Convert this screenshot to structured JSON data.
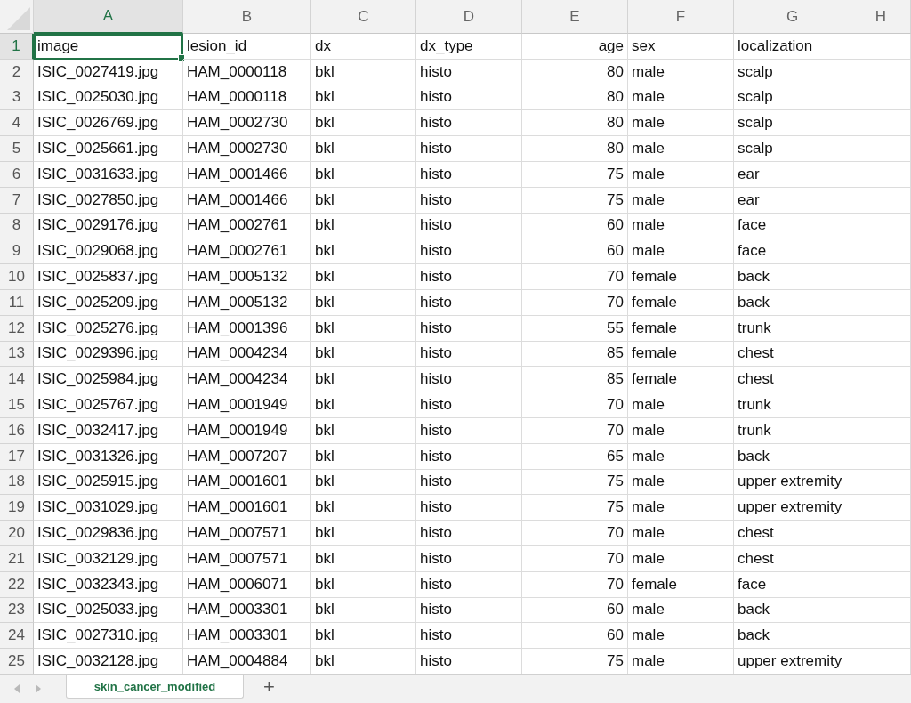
{
  "columns": [
    {
      "letter": "A",
      "selected": true,
      "kind": "text"
    },
    {
      "letter": "B",
      "selected": false,
      "kind": "text"
    },
    {
      "letter": "C",
      "selected": false,
      "kind": "text"
    },
    {
      "letter": "D",
      "selected": false,
      "kind": "text"
    },
    {
      "letter": "E",
      "selected": false,
      "kind": "number"
    },
    {
      "letter": "F",
      "selected": false,
      "kind": "text"
    },
    {
      "letter": "G",
      "selected": false,
      "kind": "text"
    },
    {
      "letter": "H",
      "selected": false,
      "kind": "text"
    }
  ],
  "rows": [
    {
      "number": "1",
      "selected": true,
      "cells": [
        "image",
        "lesion_id",
        "dx",
        "dx_type",
        "age",
        "sex",
        "localization"
      ]
    },
    {
      "number": "2",
      "selected": false,
      "cells": [
        "ISIC_0027419.jpg",
        "HAM_0000118",
        "bkl",
        "histo",
        "80",
        "male",
        "scalp"
      ]
    },
    {
      "number": "3",
      "selected": false,
      "cells": [
        "ISIC_0025030.jpg",
        "HAM_0000118",
        "bkl",
        "histo",
        "80",
        "male",
        "scalp"
      ]
    },
    {
      "number": "4",
      "selected": false,
      "cells": [
        "ISIC_0026769.jpg",
        "HAM_0002730",
        "bkl",
        "histo",
        "80",
        "male",
        "scalp"
      ]
    },
    {
      "number": "5",
      "selected": false,
      "cells": [
        "ISIC_0025661.jpg",
        "HAM_0002730",
        "bkl",
        "histo",
        "80",
        "male",
        "scalp"
      ]
    },
    {
      "number": "6",
      "selected": false,
      "cells": [
        "ISIC_0031633.jpg",
        "HAM_0001466",
        "bkl",
        "histo",
        "75",
        "male",
        "ear"
      ]
    },
    {
      "number": "7",
      "selected": false,
      "cells": [
        "ISIC_0027850.jpg",
        "HAM_0001466",
        "bkl",
        "histo",
        "75",
        "male",
        "ear"
      ]
    },
    {
      "number": "8",
      "selected": false,
      "cells": [
        "ISIC_0029176.jpg",
        "HAM_0002761",
        "bkl",
        "histo",
        "60",
        "male",
        "face"
      ]
    },
    {
      "number": "9",
      "selected": false,
      "cells": [
        "ISIC_0029068.jpg",
        "HAM_0002761",
        "bkl",
        "histo",
        "60",
        "male",
        "face"
      ]
    },
    {
      "number": "10",
      "selected": false,
      "cells": [
        "ISIC_0025837.jpg",
        "HAM_0005132",
        "bkl",
        "histo",
        "70",
        "female",
        "back"
      ]
    },
    {
      "number": "11",
      "selected": false,
      "cells": [
        "ISIC_0025209.jpg",
        "HAM_0005132",
        "bkl",
        "histo",
        "70",
        "female",
        "back"
      ]
    },
    {
      "number": "12",
      "selected": false,
      "cells": [
        "ISIC_0025276.jpg",
        "HAM_0001396",
        "bkl",
        "histo",
        "55",
        "female",
        "trunk"
      ]
    },
    {
      "number": "13",
      "selected": false,
      "cells": [
        "ISIC_0029396.jpg",
        "HAM_0004234",
        "bkl",
        "histo",
        "85",
        "female",
        "chest"
      ]
    },
    {
      "number": "14",
      "selected": false,
      "cells": [
        "ISIC_0025984.jpg",
        "HAM_0004234",
        "bkl",
        "histo",
        "85",
        "female",
        "chest"
      ]
    },
    {
      "number": "15",
      "selected": false,
      "cells": [
        "ISIC_0025767.jpg",
        "HAM_0001949",
        "bkl",
        "histo",
        "70",
        "male",
        "trunk"
      ]
    },
    {
      "number": "16",
      "selected": false,
      "cells": [
        "ISIC_0032417.jpg",
        "HAM_0001949",
        "bkl",
        "histo",
        "70",
        "male",
        "trunk"
      ]
    },
    {
      "number": "17",
      "selected": false,
      "cells": [
        "ISIC_0031326.jpg",
        "HAM_0007207",
        "bkl",
        "histo",
        "65",
        "male",
        "back"
      ]
    },
    {
      "number": "18",
      "selected": false,
      "cells": [
        "ISIC_0025915.jpg",
        "HAM_0001601",
        "bkl",
        "histo",
        "75",
        "male",
        "upper extremity"
      ]
    },
    {
      "number": "19",
      "selected": false,
      "cells": [
        "ISIC_0031029.jpg",
        "HAM_0001601",
        "bkl",
        "histo",
        "75",
        "male",
        "upper extremity"
      ]
    },
    {
      "number": "20",
      "selected": false,
      "cells": [
        "ISIC_0029836.jpg",
        "HAM_0007571",
        "bkl",
        "histo",
        "70",
        "male",
        "chest"
      ]
    },
    {
      "number": "21",
      "selected": false,
      "cells": [
        "ISIC_0032129.jpg",
        "HAM_0007571",
        "bkl",
        "histo",
        "70",
        "male",
        "chest"
      ]
    },
    {
      "number": "22",
      "selected": false,
      "cells": [
        "ISIC_0032343.jpg",
        "HAM_0006071",
        "bkl",
        "histo",
        "70",
        "female",
        "face"
      ]
    },
    {
      "number": "23",
      "selected": false,
      "cells": [
        "ISIC_0025033.jpg",
        "HAM_0003301",
        "bkl",
        "histo",
        "60",
        "male",
        "back"
      ]
    },
    {
      "number": "24",
      "selected": false,
      "cells": [
        "ISIC_0027310.jpg",
        "HAM_0003301",
        "bkl",
        "histo",
        "60",
        "male",
        "back"
      ]
    },
    {
      "number": "25",
      "selected": false,
      "cells": [
        "ISIC_0032128.jpg",
        "HAM_0004884",
        "bkl",
        "histo",
        "75",
        "male",
        "upper extremity"
      ]
    }
  ],
  "sheet_tabs": [
    {
      "label": "skin_cancer_modified",
      "selected": true
    }
  ],
  "add_sheet": "+"
}
